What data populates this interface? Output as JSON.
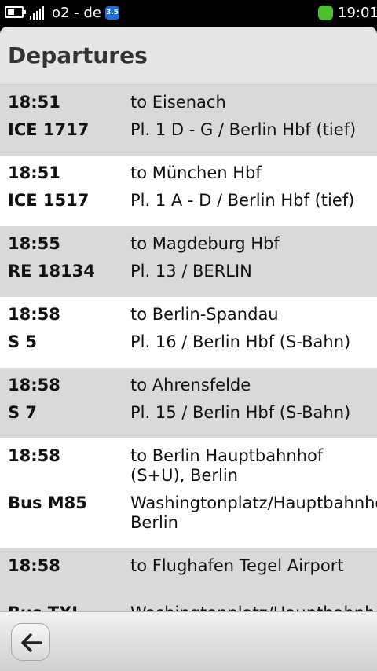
{
  "status_bar": {
    "battery_icon": "battery-icon",
    "signal_icon": "signal-bars-icon",
    "operator": "o2 - de",
    "network_badge": "3.5",
    "clock": "19:01"
  },
  "header": {
    "title": "Departures"
  },
  "departures": [
    {
      "time": "18:51",
      "train": "ICE 1717",
      "destination": "to Eisenach",
      "platform": "Pl. 1 D - G / Berlin Hbf (tief)"
    },
    {
      "time": "18:51",
      "train": "ICE 1517",
      "destination": "to München Hbf",
      "platform": "Pl. 1 A - D / Berlin Hbf (tief)"
    },
    {
      "time": "18:55",
      "train": "RE 18134",
      "destination": "to Magdeburg Hbf",
      "platform": "Pl. 13 / BERLIN"
    },
    {
      "time": "18:58",
      "train": "S 5",
      "destination": "to Berlin-Spandau",
      "platform": "Pl. 16 / Berlin Hbf (S-Bahn)"
    },
    {
      "time": "18:58",
      "train": "S 7",
      "destination": "to Ahrensfelde",
      "platform": "Pl. 15 / Berlin Hbf (S-Bahn)"
    },
    {
      "time": "18:58",
      "train": "Bus M85",
      "destination": "to Berlin Hauptbahnhof (S+U), Berlin",
      "platform": "Washingtonplatz/Hauptbahnhof, Berlin"
    },
    {
      "time": "18:58",
      "train": "Bus TXL",
      "destination": "to Flughafen Tegel Airport",
      "platform": "Washingtonplatz/Hauptbahnhof, Berlin"
    }
  ],
  "toolbar": {
    "back_icon": "back-arrow-icon"
  }
}
